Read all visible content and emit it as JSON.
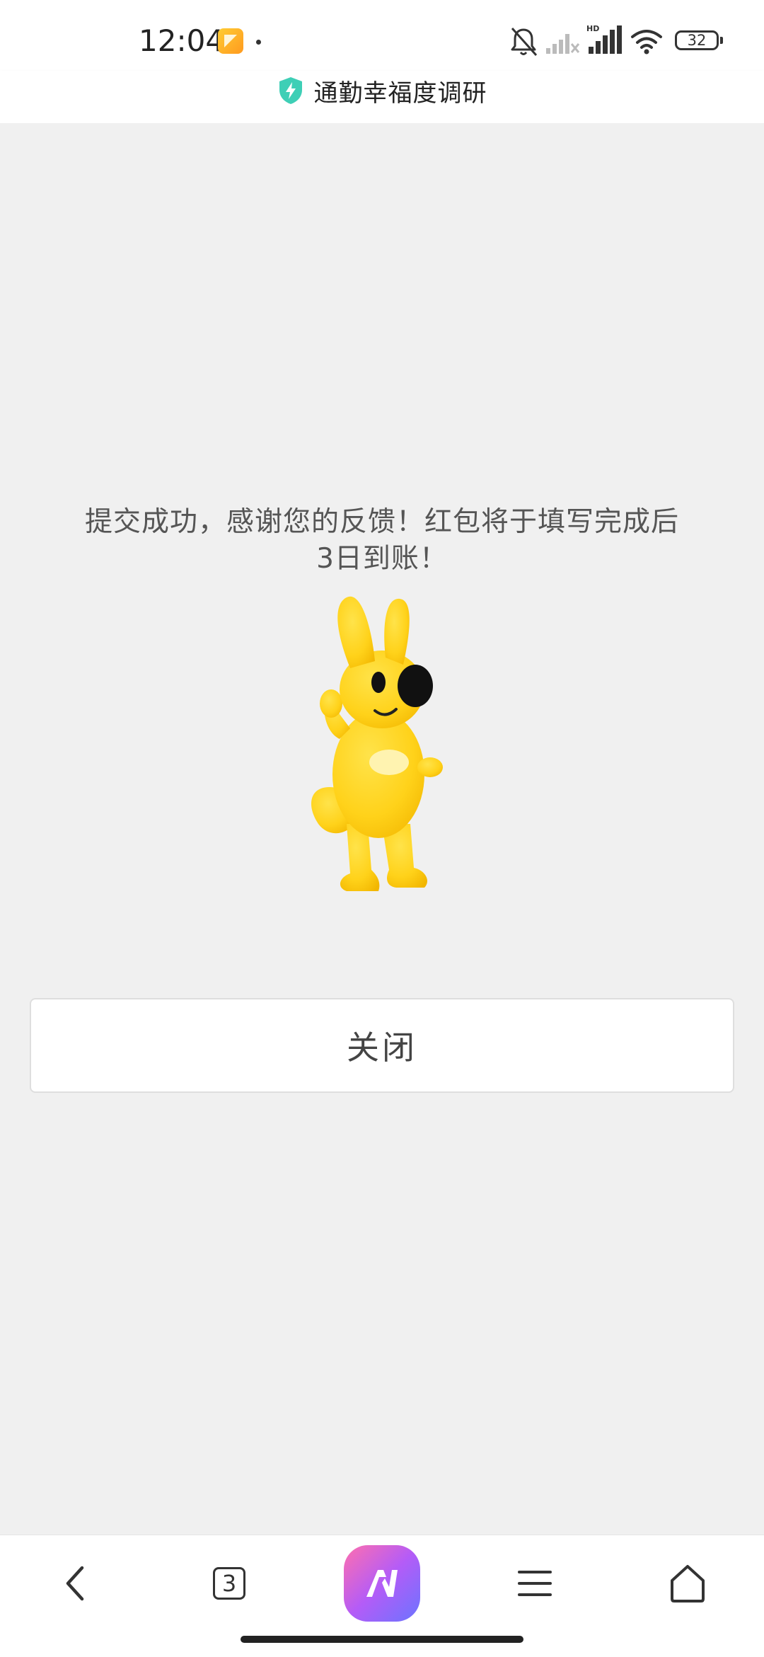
{
  "status_bar": {
    "time": "12:04",
    "battery_level": "32",
    "icons": [
      "notification-app-icon",
      "mute-icon",
      "signal-icon",
      "hd-signal-icon",
      "wifi-icon",
      "battery-icon"
    ],
    "hd_label": "HD"
  },
  "header": {
    "title": "通勤幸福度调研",
    "icon": "shield-bolt-icon",
    "icon_color": "#3ecfb6"
  },
  "main": {
    "success_message": "提交成功，感谢您的反馈！红包将于填写完成后3日到账！",
    "mascot": "yellow-kangaroo-mascot",
    "close_button_label": "关闭"
  },
  "bottom_nav": {
    "tab_count": "3",
    "items": [
      "back-icon",
      "tabs-icon",
      "ai-assistant-icon",
      "menu-icon",
      "home-icon"
    ],
    "ai_gradient": [
      "#ff6fae",
      "#b45cf7",
      "#6b74ff"
    ]
  }
}
